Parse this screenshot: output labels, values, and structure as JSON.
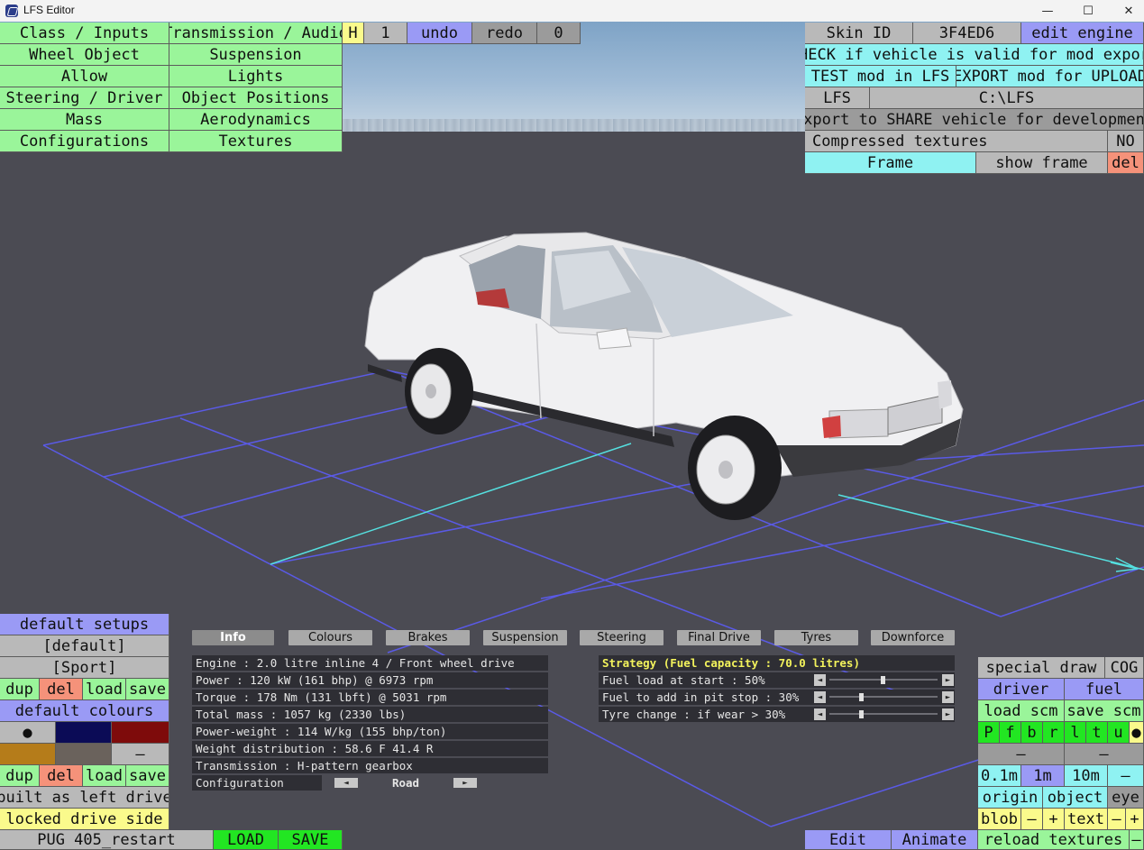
{
  "window": {
    "title": "LFS Editor",
    "minimize": "—",
    "maximize": "☐",
    "close": "✕"
  },
  "menu_left": [
    "Class / Inputs",
    "Wheel Object",
    "Allow",
    "Steering / Driver",
    "Mass",
    "Configurations"
  ],
  "menu_right": [
    "Transmission / Audio",
    "Suspension",
    "Lights",
    "Object Positions",
    "Aerodynamics",
    "Textures"
  ],
  "topbar": {
    "h": "H",
    "count": "1",
    "undo": "undo",
    "redo": "redo",
    "zero": "0"
  },
  "right_panel": {
    "skin_label": "Skin ID",
    "skin_value": "3F4ED6",
    "edit_engine": "edit engine",
    "check": "CHECK if vehicle is valid for mod export",
    "test": "TEST mod in LFS",
    "export": "EXPORT mod for UPLOAD",
    "lfs": "LFS",
    "lfs_path": "C:\\LFS",
    "share": "export to SHARE vehicle for development",
    "compressed": "Compressed textures",
    "compressed_value": "NO",
    "frame": "Frame",
    "show_frame": "show frame",
    "del": "del"
  },
  "left_bottom": {
    "default_setups": "default setups",
    "setup1": "[default]",
    "setup2": "[Sport]",
    "dup": "dup",
    "del": "del",
    "load": "load",
    "save": "save",
    "default_colours": "default colours",
    "dot": "●",
    "dash": "–",
    "built_as": "built as left drive",
    "locked": "locked drive side",
    "car_name": "PUG 405_restart",
    "load_btn": "LOAD",
    "save_btn": "SAVE"
  },
  "tabs": [
    "Info",
    "Colours",
    "Brakes",
    "Suspension",
    "Steering",
    "Final Drive",
    "Tyres",
    "Downforce"
  ],
  "info": [
    "Engine : 2.0 litre inline 4 / Front wheel drive",
    "Power : 120 kW (161 bhp) @ 6973 rpm",
    "Torque : 178 Nm (131 lbft) @ 5031 rpm",
    "Total mass : 1057 kg (2330 lbs)",
    "Power-weight : 114 W/kg (155 bhp/ton)",
    "Weight distribution : 58.6 F  41.4 R",
    "Transmission : H-pattern gearbox"
  ],
  "configuration": {
    "label": "Configuration",
    "value": "Road",
    "left": "◄",
    "right": "►"
  },
  "strategy": {
    "title": "Strategy (Fuel capacity : 70.0 litres)",
    "rows": [
      {
        "label": "Fuel load at start : 50%",
        "level": 0.5
      },
      {
        "label": "Fuel to add in pit stop : 30%",
        "level": 0.3
      },
      {
        "label": "Tyre change : if wear > 30%",
        "level": 0.3
      }
    ]
  },
  "right_bottom": {
    "special_draw": "special draw",
    "cog": "COG",
    "driver": "driver",
    "fuel": "fuel",
    "load_scm": "load scm",
    "save_scm": "save scm",
    "letters": [
      "P",
      "f",
      "b",
      "r",
      "l",
      "t",
      "u",
      "●"
    ],
    "dash": "–",
    "d1": "0.1m",
    "d2": "1m",
    "d3": "10m",
    "origin": "origin",
    "object": "object",
    "eye": "eye",
    "blob": "blob",
    "minus": "–",
    "plus": "+",
    "text": "text"
  },
  "bottom_bar": {
    "edit": "Edit",
    "animate": "Animate",
    "reload": "reload textures",
    "dash": "–"
  }
}
